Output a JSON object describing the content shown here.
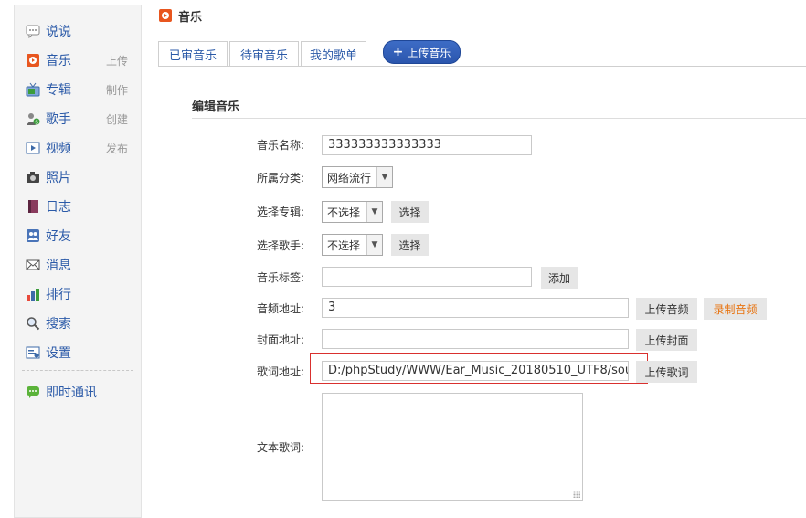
{
  "sidebar": {
    "items": [
      {
        "label": "说说",
        "extra": "",
        "icon": "speech-bubble-icon"
      },
      {
        "label": "音乐",
        "extra": "上传",
        "icon": "music-icon"
      },
      {
        "label": "专辑",
        "extra": "制作",
        "icon": "tv-album-icon"
      },
      {
        "label": "歌手",
        "extra": "创建",
        "icon": "singer-icon"
      },
      {
        "label": "视频",
        "extra": "发布",
        "icon": "video-icon"
      },
      {
        "label": "照片",
        "extra": "",
        "icon": "camera-icon"
      },
      {
        "label": "日志",
        "extra": "",
        "icon": "journal-icon"
      },
      {
        "label": "好友",
        "extra": "",
        "icon": "friends-icon"
      },
      {
        "label": "消息",
        "extra": "",
        "icon": "mail-icon"
      },
      {
        "label": "排行",
        "extra": "",
        "icon": "bar-chart-icon"
      },
      {
        "label": "搜索",
        "extra": "",
        "icon": "search-icon"
      },
      {
        "label": "设置",
        "extra": "",
        "icon": "settings-icon"
      }
    ],
    "im": {
      "label": "即时通讯",
      "icon": "chat-icon"
    }
  },
  "header": {
    "title": "音乐"
  },
  "tabs": [
    {
      "label": "已审音乐"
    },
    {
      "label": "待审音乐"
    },
    {
      "label": "我的歌单"
    }
  ],
  "upload_button": "上传音乐",
  "section_title": "编辑音乐",
  "form": {
    "name_label": "音乐名称:",
    "name_value": "333333333333333",
    "category_label": "所属分类:",
    "category_value": "网络流行",
    "album_label": "选择专辑:",
    "album_value": "不选择",
    "album_button": "选择",
    "singer_label": "选择歌手:",
    "singer_value": "不选择",
    "singer_button": "选择",
    "tags_label": "音乐标签:",
    "tags_value": "",
    "tags_button": "添加",
    "audio_label": "音频地址:",
    "audio_value": "3",
    "audio_upload_button": "上传音频",
    "audio_record_button": "录制音频",
    "cover_label": "封面地址:",
    "cover_value": "",
    "cover_upload_button": "上传封面",
    "lyrics_label": "歌词地址:",
    "lyrics_value": "D:/phpStudy/WWW/Ear_Music_20180510_UTF8/sou",
    "lyrics_upload_button": "上传歌词",
    "text_lyrics_label": "文本歌词:",
    "text_lyrics_value": ""
  },
  "colors": {
    "link": "#2b5aa8",
    "accent": "#e8730f",
    "highlight": "#d9302e",
    "upload_btn": "#2b56ad"
  }
}
